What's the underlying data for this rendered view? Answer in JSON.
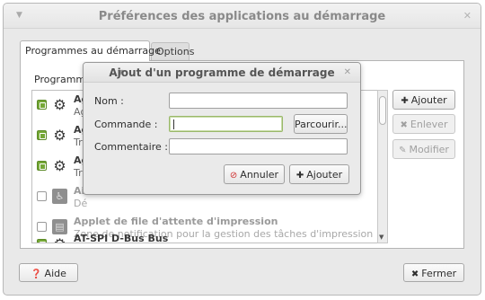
{
  "window": {
    "title": "Préférences des applications au démarrage",
    "menu_icon": "chevron-down-icon",
    "close_icon": "close-icon"
  },
  "tabs": [
    {
      "label": "Programmes au démarrage",
      "active": true
    },
    {
      "label": "Options",
      "active": false
    }
  ],
  "list": {
    "label": "Programme",
    "items": [
      {
        "title": "Ag",
        "desc": "Ag",
        "checked": true,
        "icon": "gear-icon"
      },
      {
        "title": "Ag",
        "desc": "Tro",
        "checked": true,
        "icon": "gear-icon"
      },
      {
        "title": "Ag",
        "desc": "Tro",
        "checked": true,
        "icon": "gear-icon"
      },
      {
        "title": "Aid",
        "desc": "Dé",
        "checked": false,
        "icon": "accessibility-icon"
      },
      {
        "title": "Applet de file d'attente d'impression",
        "desc": "Zone de notification pour la gestion des tâches d'impression",
        "checked": false,
        "icon": "printer-icon"
      },
      {
        "title": "AT-SPI D-Bus Bus",
        "desc": "",
        "checked": true,
        "icon": "gear-icon"
      }
    ]
  },
  "side_buttons": {
    "add": "Ajouter",
    "remove": "Enlever",
    "edit": "Modifier"
  },
  "bottom_buttons": {
    "help": "Aide",
    "close": "Fermer"
  },
  "dialog": {
    "title": "Ajout d'un programme de démarrage",
    "name_label": "Nom :",
    "name_value": "",
    "command_label": "Commande :",
    "command_value": "",
    "browse_label": "Parcourir...",
    "comment_label": "Commentaire :",
    "comment_value": "",
    "cancel_label": "Annuler",
    "add_label": "Ajouter"
  },
  "colors": {
    "checkbox_on": "#75a836",
    "cancel_icon": "#d03030",
    "window_bg": "#e9e9e9"
  }
}
